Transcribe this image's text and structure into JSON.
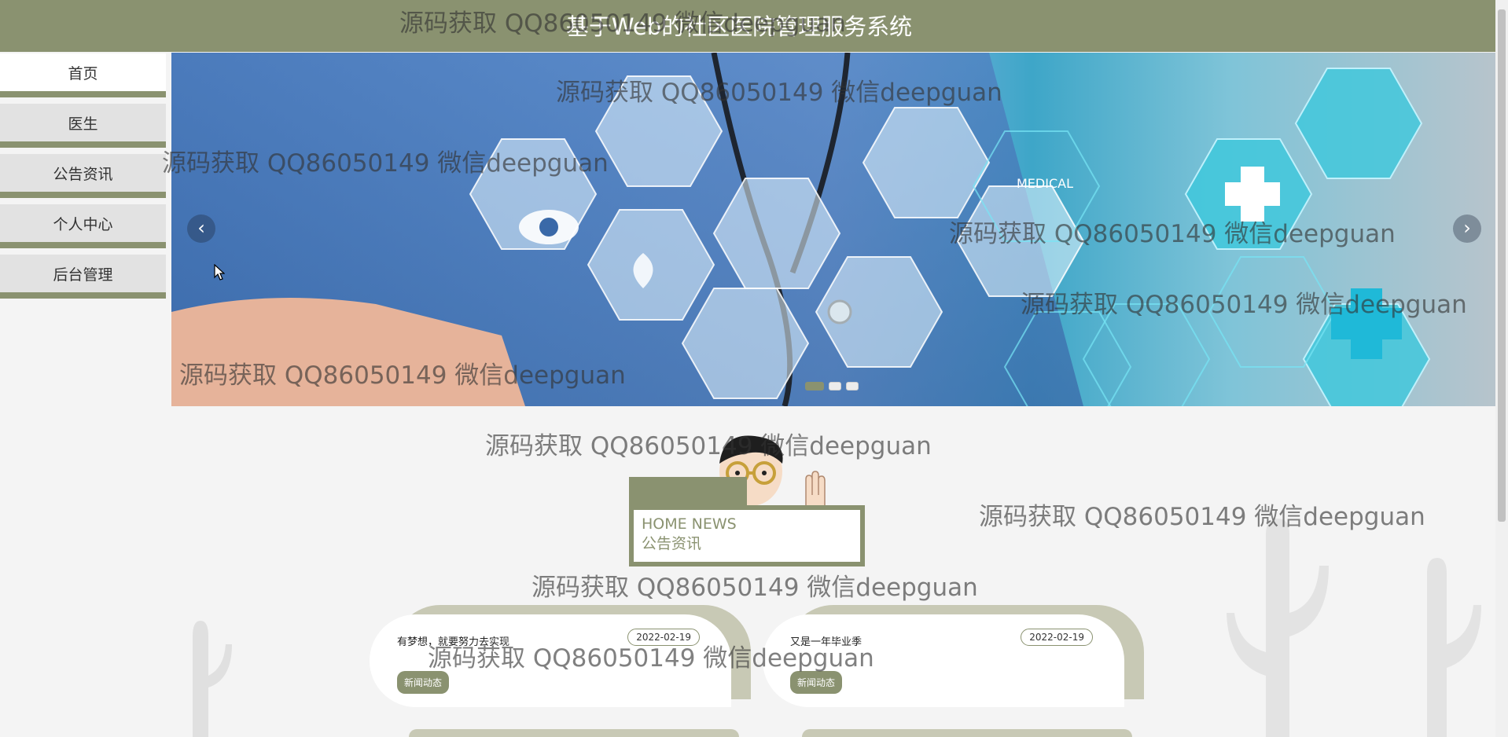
{
  "header": {
    "title": "基于Web的社区医院管理服务系统"
  },
  "sidebar": {
    "items": [
      {
        "label": "首页",
        "active": true
      },
      {
        "label": "医生"
      },
      {
        "label": "公告资讯"
      },
      {
        "label": "个人中心"
      },
      {
        "label": "后台管理"
      }
    ]
  },
  "carousel": {
    "prev_icon": "chevron-left-icon",
    "next_icon": "chevron-right-icon",
    "slide_count": 3,
    "active_slide": 1,
    "image_text": {
      "medical": "MEDICAL"
    }
  },
  "news_section": {
    "title_en": "HOME NEWS",
    "title_cn": "公告资讯"
  },
  "news_cards": [
    {
      "title": "有梦想，就要努力去实现",
      "date": "2022-02-19",
      "tag": "新闻动态"
    },
    {
      "title": "又是一年毕业季",
      "date": "2022-02-19",
      "tag": "新闻动态"
    }
  ],
  "watermark": {
    "text": "源码获取 QQ86050149 微信deepguan"
  },
  "colors": {
    "brand": "#8a9270",
    "card_back": "#c8c9b5",
    "page_bg": "#f4f4f4"
  }
}
